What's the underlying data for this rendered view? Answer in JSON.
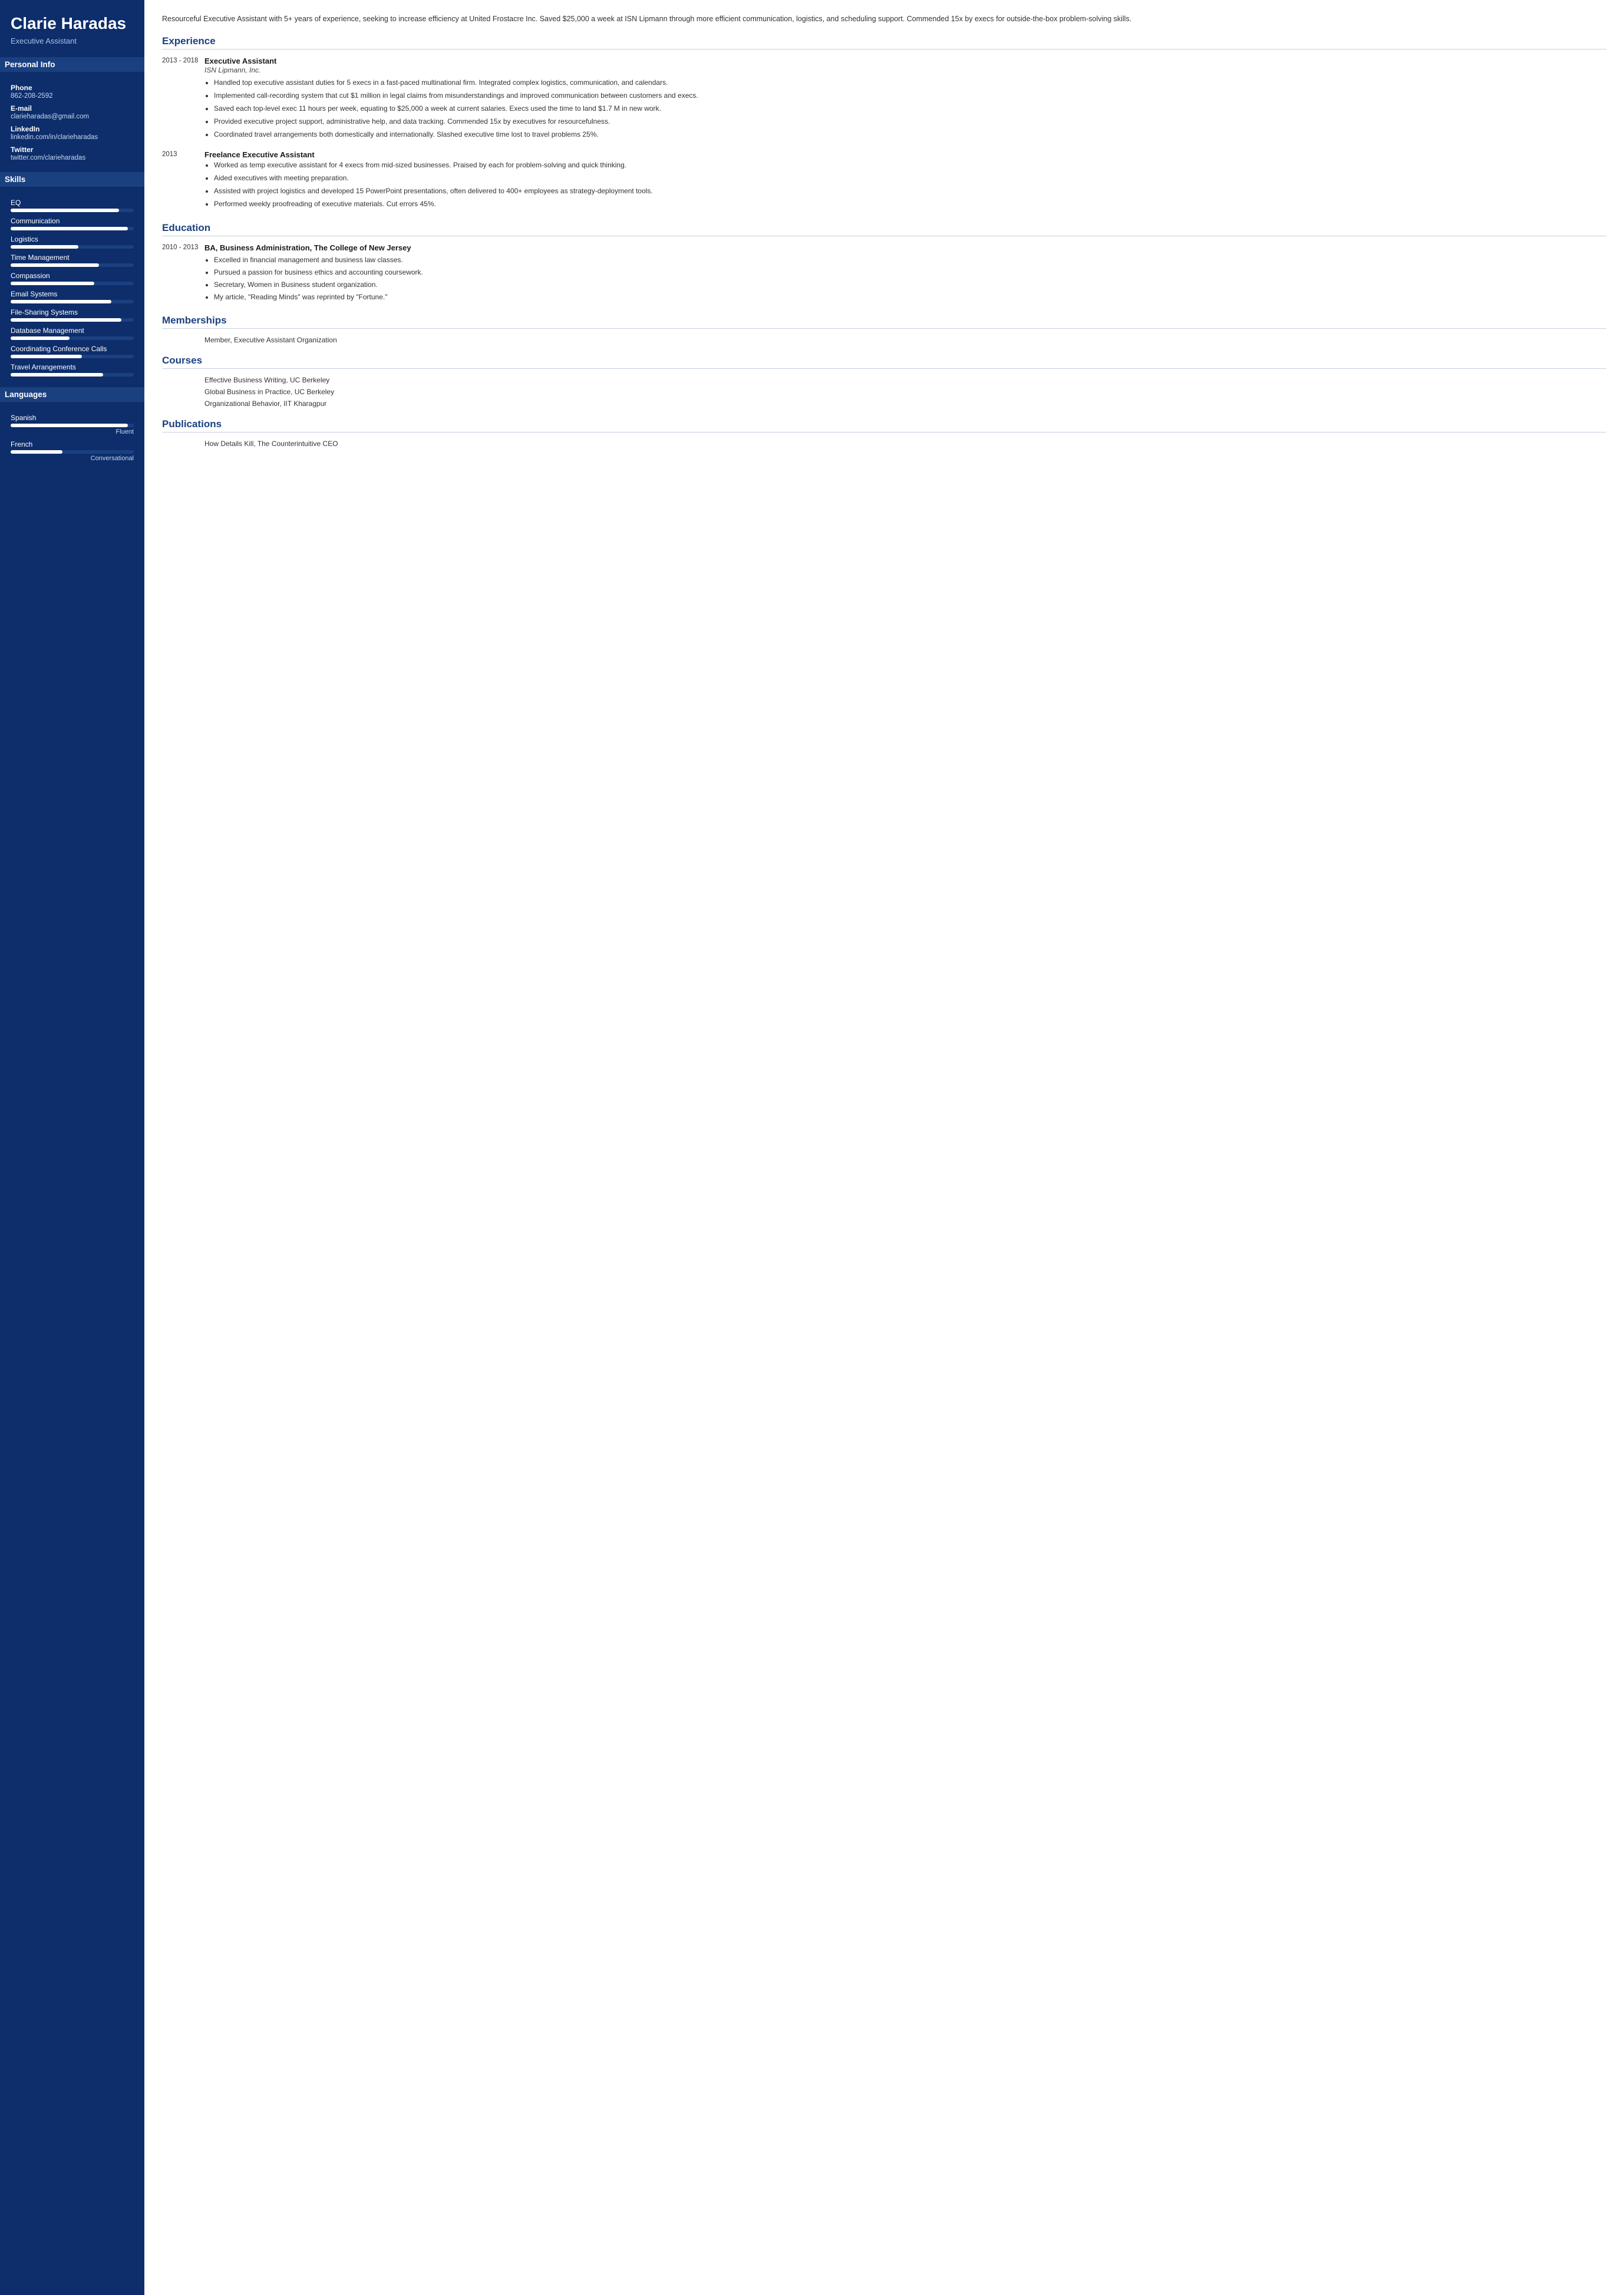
{
  "sidebar": {
    "name": "Clarie Haradas",
    "title": "Executive Assistant",
    "sections": {
      "personal_info": {
        "label": "Personal Info",
        "fields": [
          {
            "label": "Phone",
            "value": "862-208-2592"
          },
          {
            "label": "E-mail",
            "value": "clarieharadas@gmail.com"
          },
          {
            "label": "LinkedIn",
            "value": "linkedin.com/in/clarieharadas"
          },
          {
            "label": "Twitter",
            "value": "twitter.com/clarieharadas"
          }
        ]
      },
      "skills": {
        "label": "Skills",
        "items": [
          {
            "name": "EQ",
            "pct": 88
          },
          {
            "name": "Communication",
            "pct": 95
          },
          {
            "name": "Logistics",
            "pct": 55
          },
          {
            "name": "Time Management",
            "pct": 72
          },
          {
            "name": "Compassion",
            "pct": 68
          },
          {
            "name": "Email Systems",
            "pct": 82
          },
          {
            "name": "File-Sharing Systems",
            "pct": 90
          },
          {
            "name": "Database Management",
            "pct": 48
          },
          {
            "name": "Coordinating Conference Calls",
            "pct": 58
          },
          {
            "name": "Travel Arrangements",
            "pct": 75
          }
        ]
      },
      "languages": {
        "label": "Languages",
        "items": [
          {
            "name": "Spanish",
            "pct": 95,
            "level": "Fluent"
          },
          {
            "name": "French",
            "pct": 42,
            "level": "Conversational"
          }
        ]
      }
    }
  },
  "main": {
    "summary": "Resourceful Executive Assistant with 5+ years of experience, seeking to increase efficiency at United Frostacre Inc. Saved $25,000 a week at ISN Lipmann through more efficient communication, logistics, and scheduling support. Commended 15x by execs for outside-the-box problem-solving skills.",
    "experience": {
      "section_title": "Experience",
      "entries": [
        {
          "dates": "2013 - 2018",
          "job_title": "Executive Assistant",
          "company": "ISN Lipmann, Inc.",
          "bullets": [
            "Handled top executive assistant duties for 5 execs in a fast-paced multinational firm. Integrated complex logistics, communication, and calendars.",
            "Implemented call-recording system that cut $1 million in legal claims from misunderstandings and improved communication between customers and execs.",
            "Saved each top-level exec 11 hours per week, equating to $25,000 a week at current salaries. Execs used the time to land $1.7 M in new work.",
            "Provided executive project support, administrative help, and data tracking. Commended 15x by executives for resourcefulness.",
            "Coordinated travel arrangements both domestically and internationally. Slashed executive time lost to travel problems 25%."
          ]
        },
        {
          "dates": "2013",
          "job_title": "Freelance Executive Assistant",
          "company": "",
          "bullets": [
            "Worked as temp executive assistant for 4 execs from mid-sized businesses. Praised by each for problem-solving and quick thinking.",
            "Aided executives with meeting preparation.",
            "Assisted with project logistics and developed 15 PowerPoint presentations, often delivered to 400+ employees as strategy-deployment tools.",
            "Performed weekly proofreading of executive materials. Cut errors 45%."
          ]
        }
      ]
    },
    "education": {
      "section_title": "Education",
      "entries": [
        {
          "dates": "2010 - 2013",
          "degree": "BA, Business Administration, The College of New Jersey",
          "bullets": [
            "Excelled in financial management and business law classes.",
            "Pursued a passion for business ethics and accounting coursework.",
            "Secretary, Women in Business student organization.",
            "My article, \"Reading Minds\" was reprinted by \"Fortune.\""
          ]
        }
      ]
    },
    "memberships": {
      "section_title": "Memberships",
      "entries": [
        {
          "text": "Member, Executive Assistant Organization"
        }
      ]
    },
    "courses": {
      "section_title": "Courses",
      "entries": [
        {
          "text": "Effective Business Writing, UC Berkeley"
        },
        {
          "text": "Global Business in Practice, UC Berkeley"
        },
        {
          "text": "Organizational Behavior, IIT Kharagpur"
        }
      ]
    },
    "publications": {
      "section_title": "Publications",
      "entries": [
        {
          "text": "How Details Kill, The Counterintuitive CEO"
        }
      ]
    }
  }
}
